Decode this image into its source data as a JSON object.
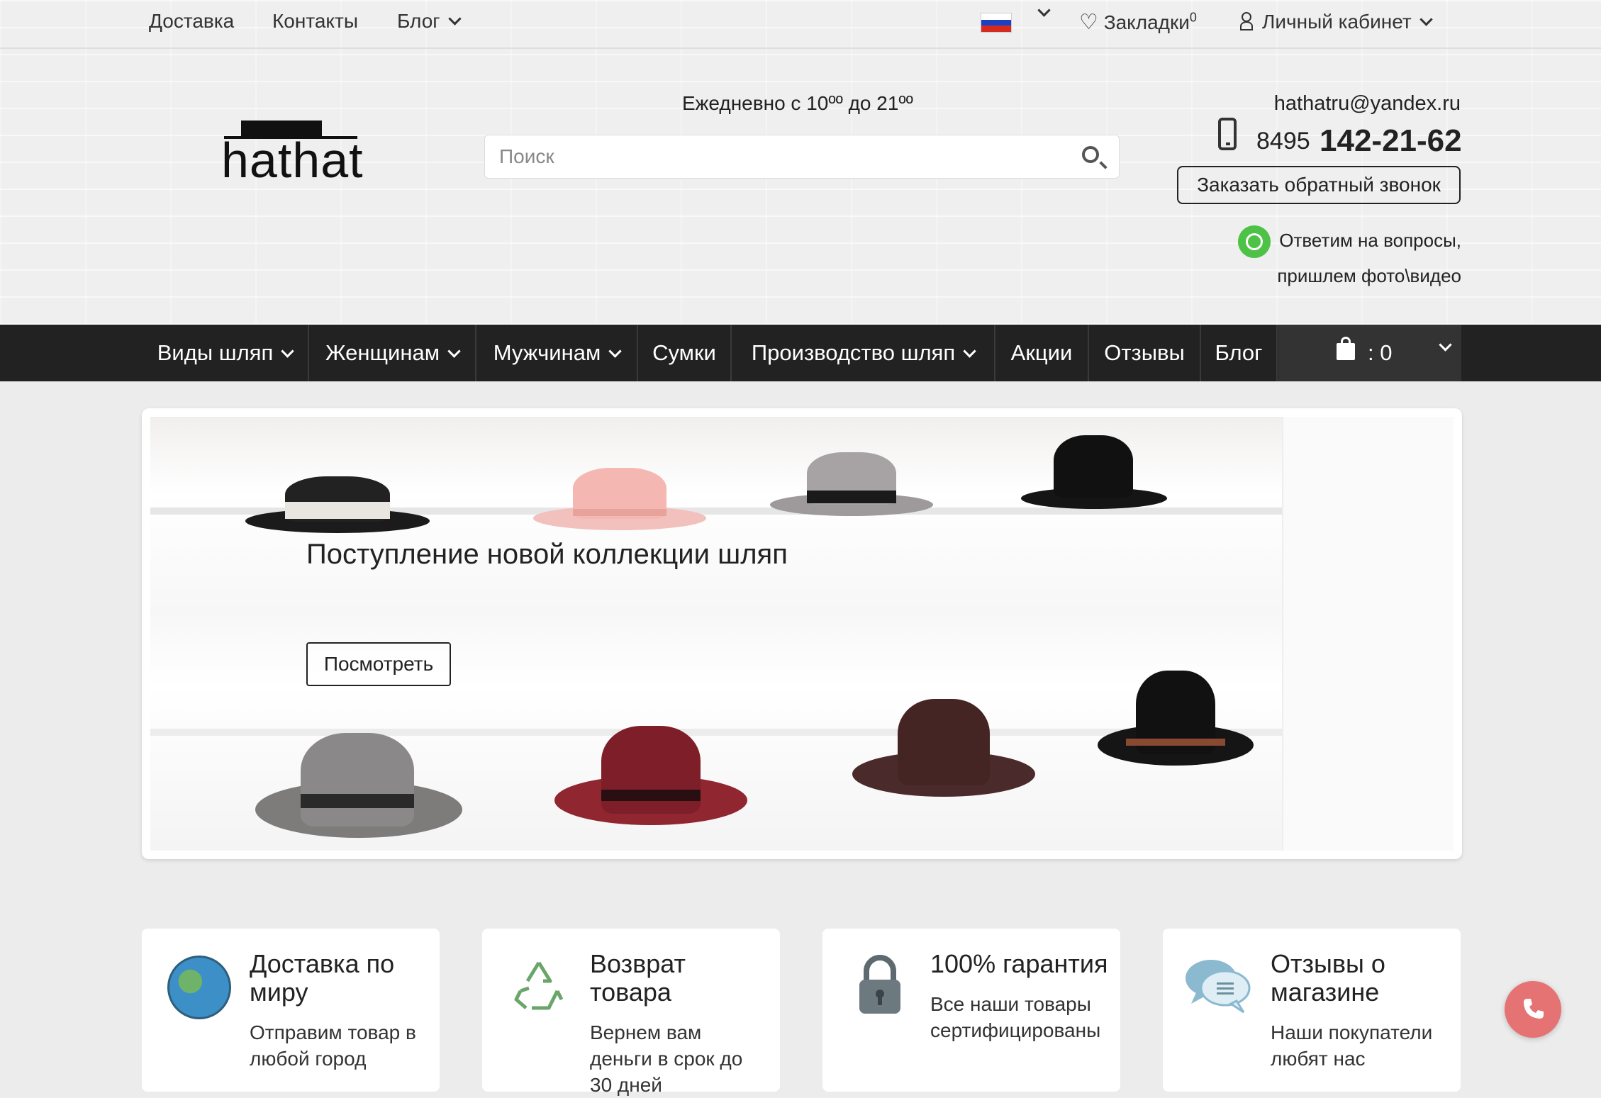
{
  "topbar": {
    "links": [
      "Доставка",
      "Контакты",
      "Блог"
    ],
    "bookmarks_label": "Закладки",
    "bookmarks_count": "0",
    "account_label": "Личный кабинет",
    "language_flag": "ru-flag"
  },
  "header": {
    "logo_text": "hathat",
    "hours": "Ежедневно с 10ºº до 21ºº",
    "search_placeholder": "Поиск",
    "email": "hathatru@yandex.ru",
    "phone_prefix": "8495",
    "phone_number": "142-21-62",
    "callback_label": "Заказать обратный звонок",
    "whatsapp_line1": "Ответим на вопросы,",
    "whatsapp_line2": "пришлем фото\\видео"
  },
  "nav": {
    "items": [
      {
        "label": "Виды шляп",
        "dropdown": true
      },
      {
        "label": "Женщинам",
        "dropdown": true
      },
      {
        "label": "Мужчинам",
        "dropdown": true
      },
      {
        "label": "Сумки",
        "dropdown": false
      },
      {
        "label": "Производство шляп",
        "dropdown": true
      },
      {
        "label": "Акции",
        "dropdown": false
      },
      {
        "label": "Отзывы",
        "dropdown": false
      },
      {
        "label": "Блог",
        "dropdown": false
      }
    ],
    "cart_count": ": 0"
  },
  "banner": {
    "title": "Поступление новой коллекции шляп",
    "button_label": "Посмотреть"
  },
  "features": [
    {
      "icon": "globe-icon",
      "title": "Доставка по миру",
      "text": "Отправим товар в любой город"
    },
    {
      "icon": "recycle-icon",
      "title": "Возврат товара",
      "text": "Вернем вам деньги в срок до 30 дней"
    },
    {
      "icon": "lock-icon",
      "title": "100% гарантия",
      "text": "Все наши товары сертифицированы"
    },
    {
      "icon": "chat-icon",
      "title": "Отзывы о магазине",
      "text": "Наши покупатели любят нас"
    }
  ],
  "colors": {
    "nav_bg": "#222222",
    "accent_call": "#e57373",
    "whatsapp": "#4dc247"
  }
}
